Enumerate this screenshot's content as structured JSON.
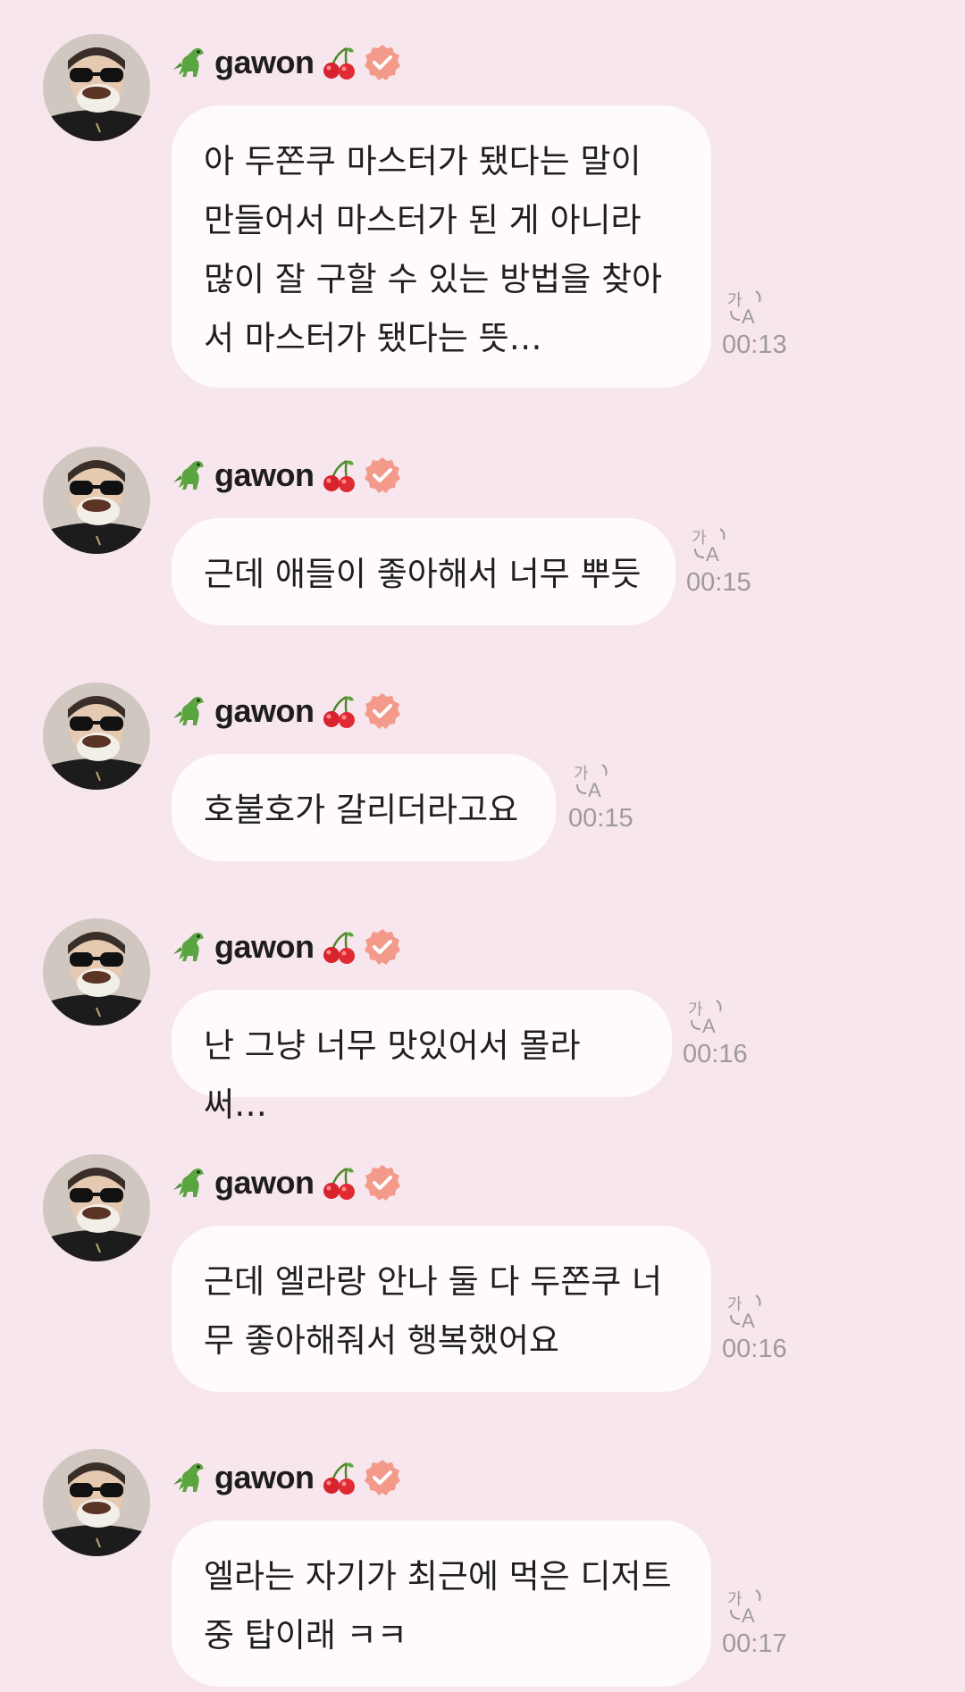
{
  "colors": {
    "background": "#f8e6ee",
    "bubble": "#fffafc",
    "timestamp": "#9d9a9c",
    "verified_badge": "#f39a8b"
  },
  "icons": {
    "dino": "t-rex-emoji",
    "cherry": "cherry-emoji",
    "verified": "verified-check-badge",
    "translate": "translate-icon"
  },
  "messages": [
    {
      "username": "gawon",
      "text": "아 두쫀쿠 마스터가 됐다는 말이\n만들어서 마스터가 된 게 아니라\n많이 잘 구할 수 있는 방법을 찾아\n서 마스터가 됐다는 뜻…",
      "time": "00:13"
    },
    {
      "username": "gawon",
      "text": "근데 애들이 좋아해서 너무 뿌듯",
      "time": "00:15"
    },
    {
      "username": "gawon",
      "text": "호불호가 갈리더라고요",
      "time": "00:15"
    },
    {
      "username": "gawon",
      "text": "난 그냥 너무 맛있어서 몰라써…",
      "time": "00:16"
    },
    {
      "username": "gawon",
      "text": "근데 엘라랑 안나 둘 다 두쫀쿠 너\n무 좋아해줘서 행복했어요",
      "time": "00:16"
    },
    {
      "username": "gawon",
      "text": "엘라는 자기가 최근에 먹은 디저트\n중 탑이래 ㅋㅋ",
      "time": "00:17"
    }
  ]
}
